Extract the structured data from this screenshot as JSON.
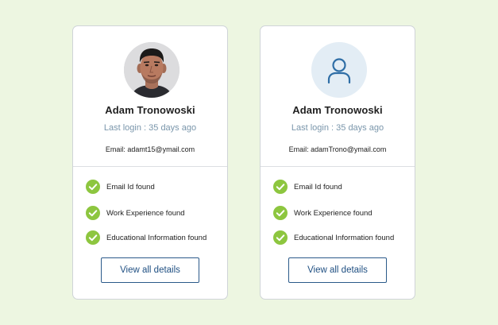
{
  "colors": {
    "background": "#edf6e1",
    "check": "#8dc63f",
    "button_border": "#2b5a8a",
    "muted_text": "#7a96ab"
  },
  "cards": [
    {
      "avatar": "user-photo",
      "name": "Adam Tronowoski",
      "last_login": "Last login : 35 days ago",
      "email": "Email: adamt15@ymail.com",
      "checks": [
        {
          "icon": "check-circle-icon",
          "label": "Email Id found"
        },
        {
          "icon": "check-circle-icon",
          "label": "Work Experience found"
        },
        {
          "icon": "check-circle-icon",
          "label": "Educational Information found"
        }
      ],
      "button_label": "View all details"
    },
    {
      "avatar": "user-placeholder-icon",
      "name": "Adam Tronowoski",
      "last_login": "Last login : 35 days ago",
      "email": "Email: adamTrono@ymail.com",
      "checks": [
        {
          "icon": "check-circle-icon",
          "label": "Email Id found"
        },
        {
          "icon": "check-circle-icon",
          "label": "Work Experience found"
        },
        {
          "icon": "check-circle-icon",
          "label": "Educational Information found"
        }
      ],
      "button_label": "View all details"
    }
  ]
}
